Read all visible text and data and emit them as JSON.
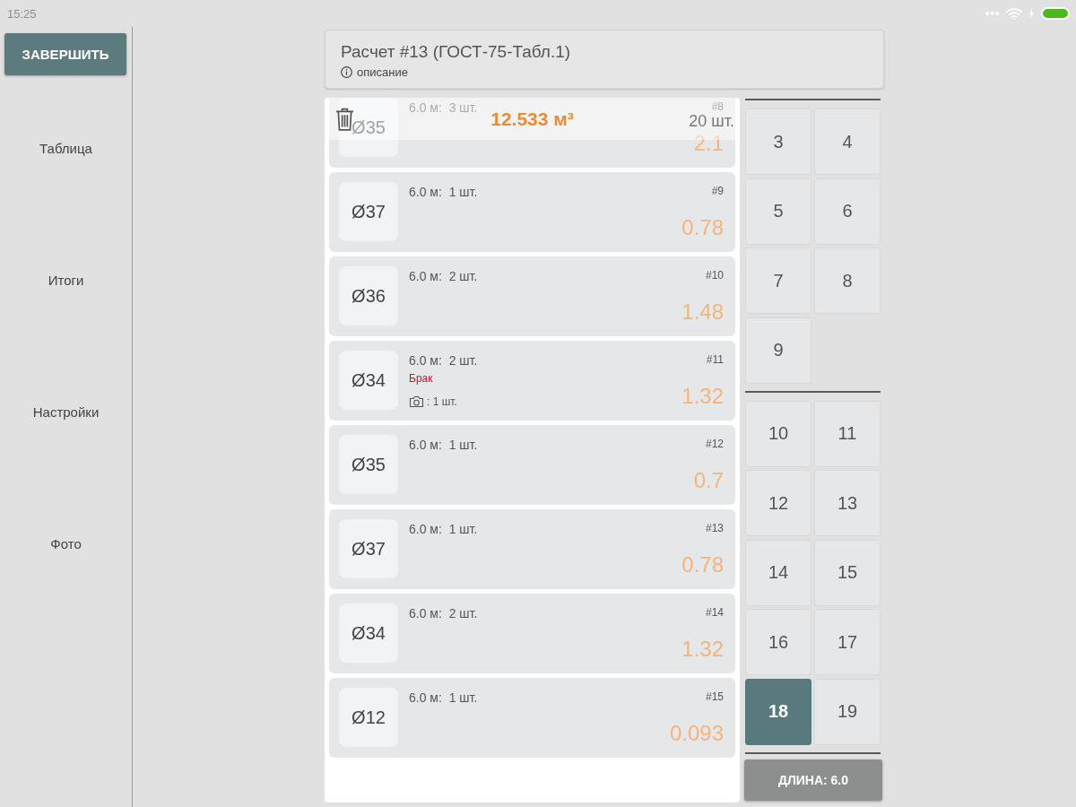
{
  "status_bar": {
    "time": "15:25"
  },
  "sidebar": {
    "finish_button": "ЗАВЕРШИТЬ",
    "items": [
      {
        "label": "Таблица"
      },
      {
        "label": "Итоги"
      },
      {
        "label": "Настройки"
      },
      {
        "label": "Фото"
      }
    ]
  },
  "header": {
    "title": "Расчет #13 (ГОСТ-75-Табл.1)",
    "description": "описание"
  },
  "summary": {
    "volume": "12.533 м³",
    "count": "20 шт."
  },
  "rows": [
    {
      "diameter": "Ø35",
      "measure": "6.0 м:  3 шт.",
      "number": "#8",
      "volume": "2.1"
    },
    {
      "diameter": "Ø37",
      "measure": "6.0 м:  1 шт.",
      "number": "#9",
      "volume": "0.78"
    },
    {
      "diameter": "Ø36",
      "measure": "6.0 м:  2 шт.",
      "number": "#10",
      "volume": "1.48"
    },
    {
      "diameter": "Ø34",
      "measure": "6.0 м:  2 шт.",
      "number": "#11",
      "volume": "1.32",
      "defect": "Брак",
      "photos": ": 1 шт."
    },
    {
      "diameter": "Ø35",
      "measure": "6.0 м:  1 шт.",
      "number": "#12",
      "volume": "0.7"
    },
    {
      "diameter": "Ø37",
      "measure": "6.0 м:  1 шт.",
      "number": "#13",
      "volume": "0.78"
    },
    {
      "diameter": "Ø34",
      "measure": "6.0 м:  2 шт.",
      "number": "#14",
      "volume": "1.32"
    },
    {
      "diameter": "Ø12",
      "measure": "6.0 м:  1 шт.",
      "number": "#15",
      "volume": "0.093"
    }
  ],
  "keypad": {
    "groups": [
      {
        "keys": [
          {
            "label": "3",
            "selected": false
          },
          {
            "label": "4",
            "selected": false
          },
          {
            "label": "5",
            "selected": false
          },
          {
            "label": "6",
            "selected": false
          },
          {
            "label": "7",
            "selected": false
          },
          {
            "label": "8",
            "selected": false
          },
          {
            "label": "9",
            "selected": false
          }
        ]
      },
      {
        "keys": [
          {
            "label": "10",
            "selected": false
          },
          {
            "label": "11",
            "selected": false
          },
          {
            "label": "12",
            "selected": false
          },
          {
            "label": "13",
            "selected": false
          },
          {
            "label": "14",
            "selected": false
          },
          {
            "label": "15",
            "selected": false
          },
          {
            "label": "16",
            "selected": false
          },
          {
            "label": "17",
            "selected": false
          },
          {
            "label": "18",
            "selected": true
          },
          {
            "label": "19",
            "selected": false
          }
        ]
      }
    ],
    "length_button": "ДЛИНА: 6.0"
  }
}
